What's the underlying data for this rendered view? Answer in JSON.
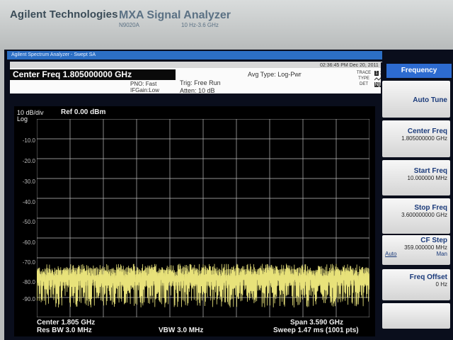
{
  "bezel": {
    "brand": "Agilent Technologies",
    "model": "MXA Signal Analyzer",
    "model_number": "N9020A",
    "freq_range": "10 Hz-3.6 GHz"
  },
  "window": {
    "title": "Agilent Spectrum Analyzer - Swept SA"
  },
  "settings": {
    "center_freq_label": "Center Freq 1.805000000 GHz",
    "pno": "PNO: Fast",
    "ifgain": "IFGain:Low",
    "trig": "Trig: Free Run",
    "atten": "Atten: 10 dB",
    "avg_type": "Avg Type: Log-Pwr",
    "timestamp": "02:36:45 PM Dec 20, 2011",
    "trace_labels": [
      "TRACE",
      "TYPE",
      "DET"
    ],
    "trace_numbers": [
      "1",
      "2",
      "3",
      "4",
      "5",
      "6"
    ],
    "det_values": [
      "N",
      "N",
      "N",
      "N",
      "N",
      "N"
    ]
  },
  "plot": {
    "scale": "10 dB/div",
    "ref": "Ref 0.00 dBm",
    "log": "Log",
    "yticks": [
      "-10.0",
      "-20.0",
      "-30.0",
      "-40.0",
      "-50.0",
      "-60.0",
      "-70.0",
      "-80.0",
      "-90.0"
    ],
    "center": "Center 1.805 GHz",
    "res_bw": "Res BW 3.0 MHz",
    "vbw": "VBW 3.0 MHz",
    "span": "Span 3.590 GHz",
    "sweep": "Sweep   1.47 ms (1001 pts)",
    "trace_color": "#e8e27a",
    "noise_floor_dbm": -76,
    "noise_low_dbm": -95
  },
  "softkeys": {
    "header": "Frequency",
    "auto_tune": "Auto Tune",
    "center_freq": {
      "label": "Center Freq",
      "value": "1.805000000 GHz"
    },
    "start_freq": {
      "label": "Start Freq",
      "value": "10.000000 MHz"
    },
    "stop_freq": {
      "label": "Stop Freq",
      "value": "3.600000000 GHz"
    },
    "cf_step": {
      "label": "CF Step",
      "value": "359.000000 MHz",
      "auto": "Auto",
      "man": "Man"
    },
    "freq_offset": {
      "label": "Freq Offset",
      "value": "0 Hz"
    }
  }
}
